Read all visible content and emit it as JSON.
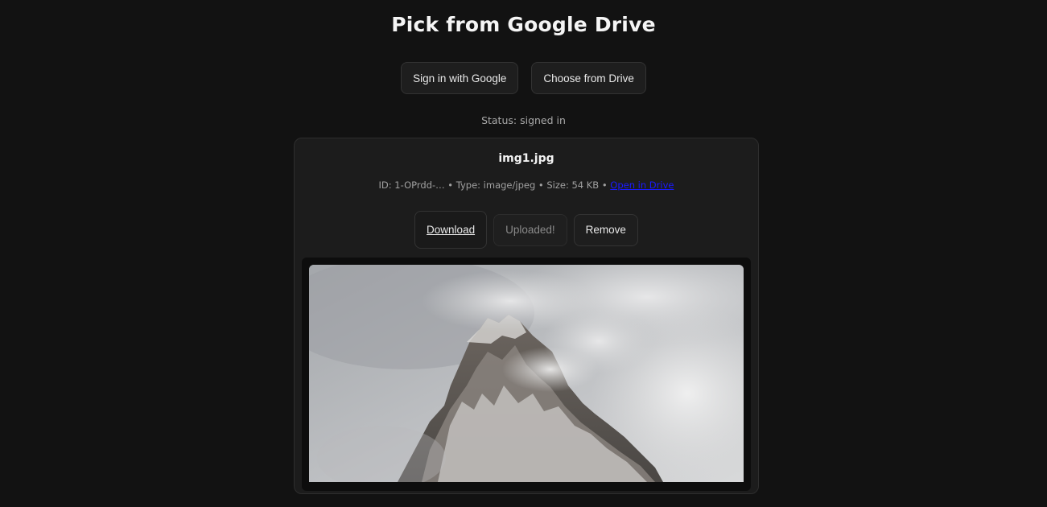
{
  "page": {
    "title": "Pick from Google Drive"
  },
  "actions": {
    "sign_in_label": "Sign in with Google",
    "choose_label": "Choose from Drive"
  },
  "status": {
    "text": "Status: signed in"
  },
  "file": {
    "name": "img1.jpg",
    "meta_text": "ID: 1-OPrdd-… • Type: image/jpeg • Size: 54 KB • ",
    "open_link_label": "Open in Drive",
    "download_label": "Download",
    "uploaded_label": "Uploaded!",
    "remove_label": "Remove",
    "preview_icon": "mountain-peak-in-clouds-photo"
  },
  "colors": {
    "background": "#121212",
    "card": "#1c1c1c",
    "link": "#1a1aff",
    "muted_text": "#a9a9a9"
  }
}
